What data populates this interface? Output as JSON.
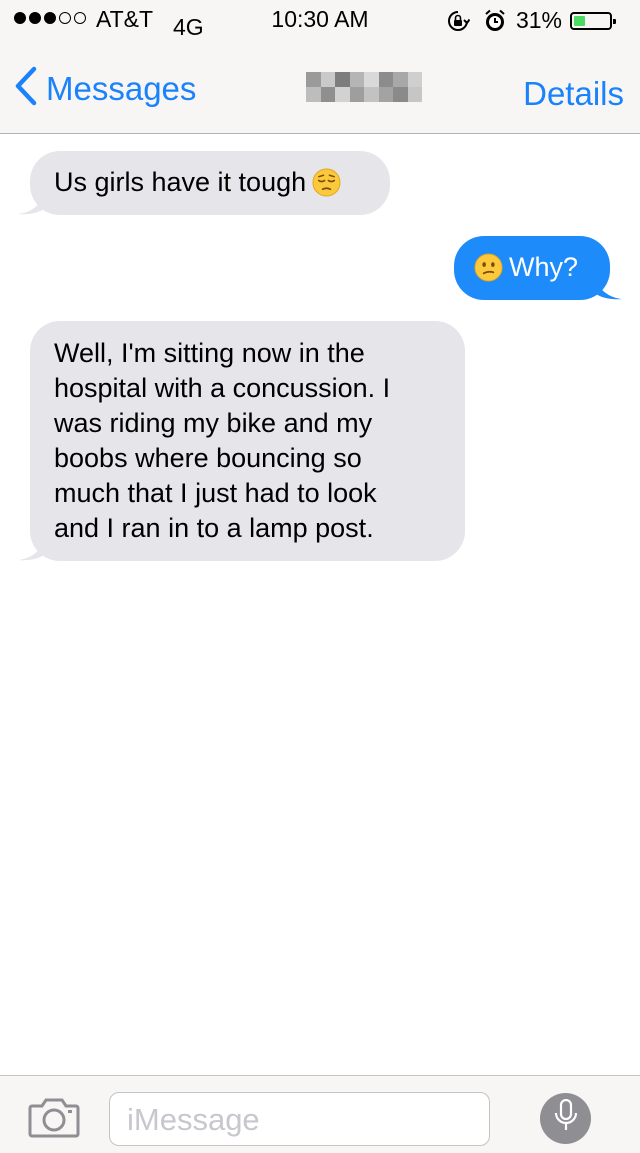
{
  "status_bar": {
    "signal_bars_filled": 3,
    "signal_bars_total": 5,
    "carrier": "AT&T",
    "network": "4G",
    "time": "10:30 AM",
    "orientation_lock_icon": "orientation-lock-icon",
    "alarm_icon": "alarm-icon",
    "battery_percent_label": "31%",
    "battery_level": 0.31,
    "battery_fill_color": "#4cd964"
  },
  "nav": {
    "back_label": "Messages",
    "back_icon": "chevron-left-icon",
    "contact_name_obscured": true,
    "details_label": "Details",
    "accent_color": "#1a82fb"
  },
  "messages": [
    {
      "direction": "incoming",
      "text": "Us girls have it tough",
      "emoji": "pensive-face-emoji"
    },
    {
      "direction": "outgoing",
      "text": "Why?",
      "emoji": "confused-face-emoji"
    },
    {
      "direction": "incoming",
      "text": "Well, I'm sitting now in the\nhospital with a concussion. I\nwas riding my bike and my\nboobs where bouncing so\nmuch that I just had to look\nand I ran in to a lamp post."
    }
  ],
  "colors": {
    "incoming_bubble": "#e5e5ea",
    "outgoing_bubble": "#1e8bfb"
  },
  "input_bar": {
    "camera_icon": "camera-icon",
    "placeholder": "iMessage",
    "mic_icon": "microphone-icon"
  }
}
